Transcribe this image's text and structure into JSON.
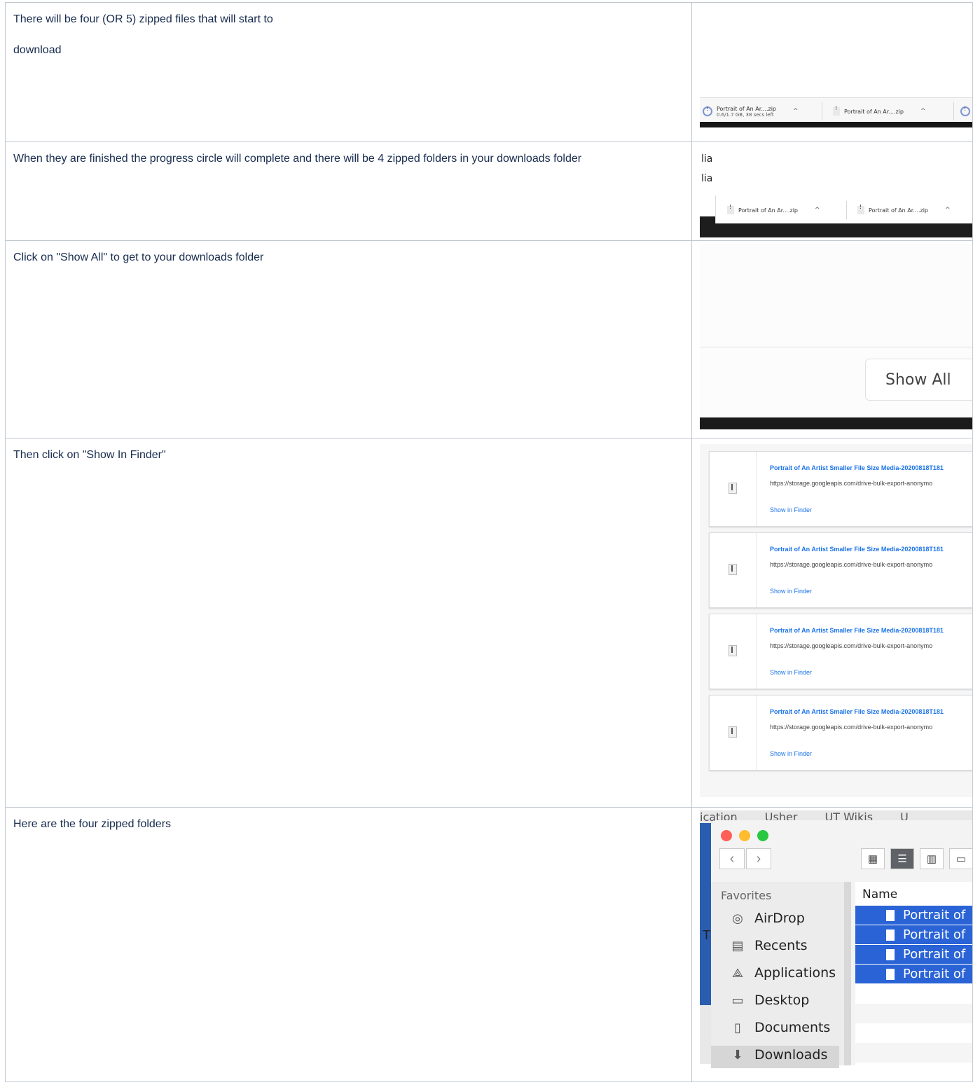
{
  "rows": [
    {
      "text_lines": [
        "There will be four (OR 5) zipped files that will start to",
        "download"
      ]
    },
    {
      "text": "When they are finished the progress circle will complete and there will be 4 zipped folders in your downloads folder"
    },
    {
      "text": "Click on \"Show All\" to get to your downloads folder"
    },
    {
      "text": "Then click on \"Show In Finder\""
    },
    {
      "text": "Here are the four zipped folders"
    }
  ],
  "download_bar_1": {
    "chip1_name": "Portrait of An Ar....zip",
    "chip1_status": "0.6/1.7 GB, 38 secs left",
    "chip2_name": "Portrait of An Ar....zip",
    "caret": "^"
  },
  "download_bar_2": {
    "fragment_top": "lia",
    "fragment_bottom": "lia",
    "chip1_name": "Portrait of An Ar....zip",
    "chip2_name": "Portrait of An Ar....zip",
    "caret": "^"
  },
  "show_all": {
    "label": "Show All"
  },
  "downloads_page": {
    "items": [
      {
        "title": "Portrait of An Artist Smaller File Size Media-20200818T181",
        "url": "https://storage.googleapis.com/drive-bulk-export-anonymo",
        "action": "Show in Finder"
      },
      {
        "title": "Portrait of An Artist Smaller File Size Media-20200818T181",
        "url": "https://storage.googleapis.com/drive-bulk-export-anonymo",
        "action": "Show in Finder"
      },
      {
        "title": "Portrait of An Artist Smaller File Size Media-20200818T181",
        "url": "https://storage.googleapis.com/drive-bulk-export-anonymo",
        "action": "Show in Finder"
      },
      {
        "title": "Portrait of An Artist Smaller File Size Media-20200818T181",
        "url": "https://storage.googleapis.com/drive-bulk-export-anonymo",
        "action": "Show in Finder"
      }
    ]
  },
  "finder": {
    "bookmarks": [
      "ication",
      "Usher",
      "UT Wikis",
      "U"
    ],
    "side_fragment": "T",
    "favorites_label": "Favorites",
    "sidebar_items": [
      {
        "label": "AirDrop",
        "icon": "airdrop-icon"
      },
      {
        "label": "Recents",
        "icon": "recents-icon"
      },
      {
        "label": "Applications",
        "icon": "applications-icon"
      },
      {
        "label": "Desktop",
        "icon": "desktop-icon"
      },
      {
        "label": "Documents",
        "icon": "documents-icon"
      },
      {
        "label": "Downloads",
        "icon": "downloads-icon"
      }
    ],
    "column_header": "Name",
    "files": [
      "Portrait of",
      "Portrait of",
      "Portrait of",
      "Portrait of"
    ],
    "colors": {
      "selection": "#2a63d6",
      "close": "#fe5f57",
      "minimize": "#febc2e",
      "zoom": "#28c840"
    }
  }
}
